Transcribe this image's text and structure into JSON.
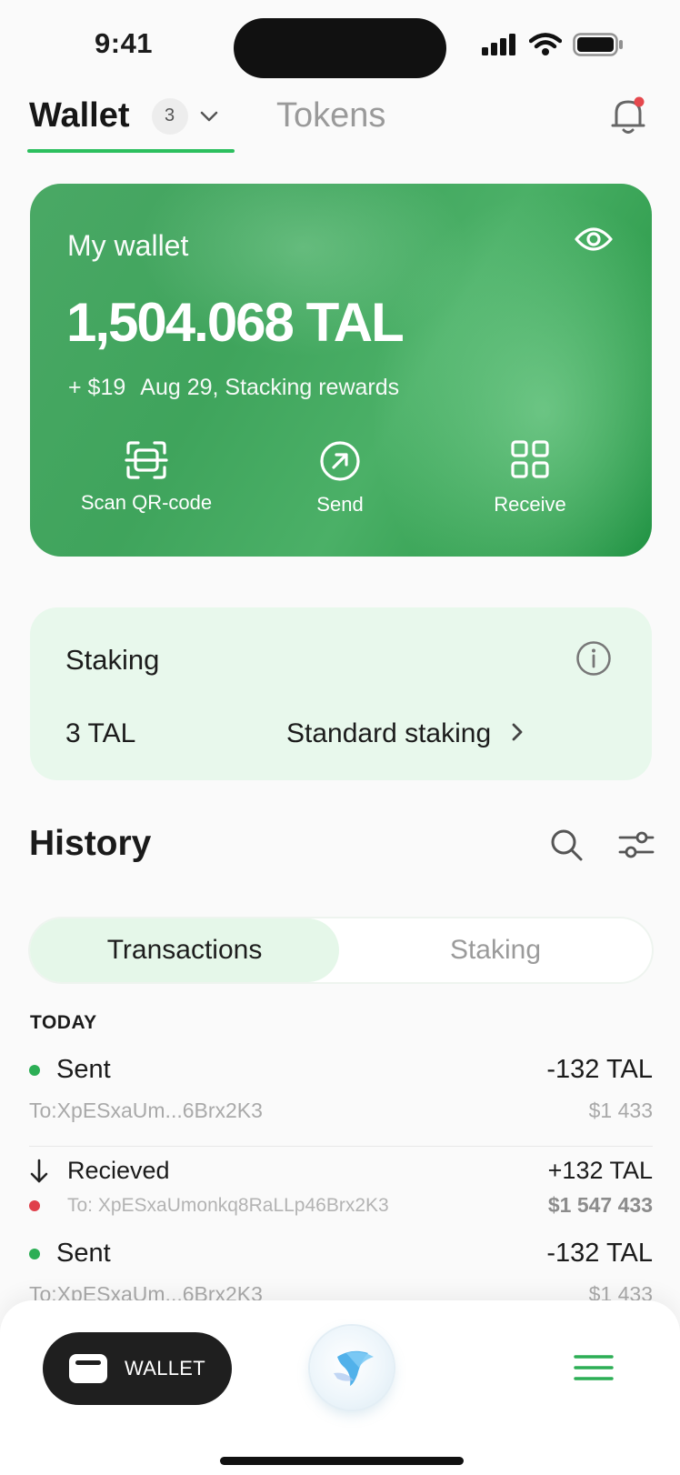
{
  "status_bar": {
    "time": "9:41"
  },
  "header": {
    "wallet_tab": "Wallet",
    "wallet_count": "3",
    "tokens_tab": "Tokens"
  },
  "wallet_card": {
    "title": "My wallet",
    "balance": "1,504.068 TAL",
    "reward_amount": "+ $19",
    "reward_text": "Aug 29, Stacking rewards",
    "actions": {
      "scan": "Scan QR-code",
      "send": "Send",
      "receive": "Receive"
    }
  },
  "staking_card": {
    "title": "Staking",
    "amount": "3 TAL",
    "type": "Standard staking"
  },
  "history": {
    "title": "History",
    "segments": {
      "active": "Transactions",
      "inactive": "Staking"
    },
    "group_label": "TODAY",
    "transactions": [
      {
        "type": "Sent",
        "address": "To:XpESxaUm...6Brx2K3",
        "amount": "-132 TAL",
        "usd": "$1 433",
        "status_color": "#2cae55"
      },
      {
        "type": "Recieved",
        "address": "To: XpESxaUmonkq8RaLLp46Brx2K3",
        "amount": "+132 TAL",
        "usd": "$1 547 433",
        "status_color": "#e0404b"
      },
      {
        "type": "Sent",
        "address": "To:XpESxaUm...6Brx2K3",
        "amount": "-132 TAL",
        "usd": "$1 433",
        "status_color": "#2cae55"
      }
    ]
  },
  "bottom_nav": {
    "wallet_label": "WALLET"
  },
  "colors": {
    "accent": "#2cbf5e",
    "card_green": "#3fa45c",
    "staking_bg": "#e8f8ec",
    "notification_dot": "#e5484d"
  },
  "icons": [
    "signal-icon",
    "wifi-icon",
    "battery-icon",
    "chevron-down-icon",
    "bell-icon",
    "eye-icon",
    "scan-qr-icon",
    "send-arrow-icon",
    "qr-code-icon",
    "info-icon",
    "chevron-right-icon",
    "search-icon",
    "filter-icon",
    "arrow-down-icon",
    "wallet-icon",
    "ai-orb-icon",
    "menu-icon"
  ]
}
